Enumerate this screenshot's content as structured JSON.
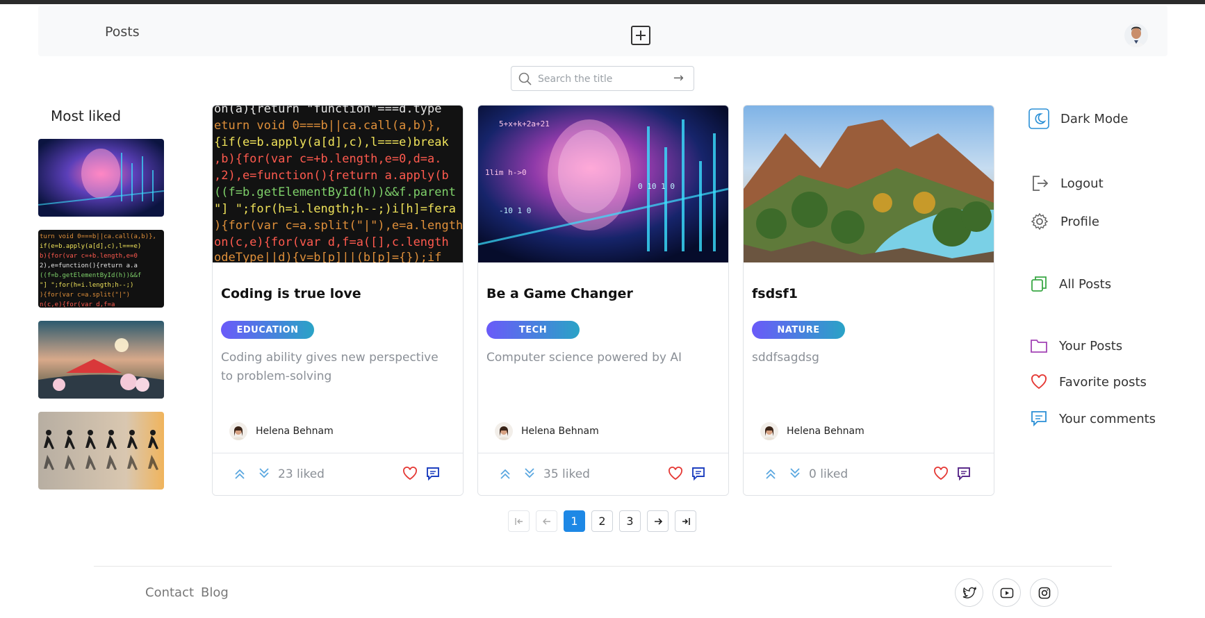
{
  "header": {
    "brand": "Posts"
  },
  "search": {
    "placeholder": "Search the title"
  },
  "most_liked": {
    "title": "Most liked"
  },
  "posts": [
    {
      "title": "Coding is true love",
      "tag": "EDUCATION",
      "desc": "Coding ability gives new perspective to problem-solving",
      "author": "Helena Behnam",
      "likes": "23 liked"
    },
    {
      "title": "Be a Game Changer",
      "tag": "TECH",
      "desc": "Computer science powered by AI",
      "author": "Helena Behnam",
      "likes": "35 liked"
    },
    {
      "title": "fsdsf1",
      "tag": "NATURE",
      "desc": "sddfsagdsg",
      "author": "Helena Behnam",
      "likes": "0 liked"
    }
  ],
  "sidebar": {
    "dark_mode": "Dark Mode",
    "logout": "Logout",
    "profile": "Profile",
    "all_posts": "All Posts",
    "your_posts": "Your Posts",
    "favorite_posts": "Favorite posts",
    "your_comments": "Your comments"
  },
  "pagination": {
    "pages": [
      "1",
      "2",
      "3"
    ],
    "current": "1"
  },
  "footer": {
    "contact": "Contact",
    "blog": "Blog"
  },
  "colors": {
    "accent": "#1e88e5",
    "heart": "#e53935",
    "tag_start": "#6a5af9",
    "tag_end": "#2aa3c6"
  }
}
